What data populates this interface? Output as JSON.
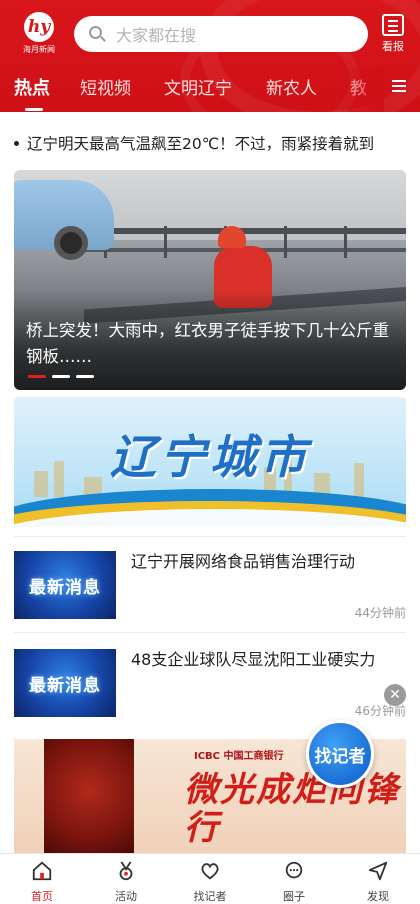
{
  "header": {
    "logo_text": "海月新闻",
    "search_placeholder": "大家都在搜",
    "paper_label": "看报"
  },
  "tabs": [
    {
      "label": "热点",
      "active": true
    },
    {
      "label": "短视频"
    },
    {
      "label": "文明辽宁"
    },
    {
      "label": "新农人"
    },
    {
      "label": "教"
    }
  ],
  "ticker": {
    "text": "辽宁明天最高气温飙至20℃！不过，雨紧接着就到"
  },
  "carousel": {
    "caption": "桥上突发！大雨中，红衣男子徒手按下几十公斤重钢板……",
    "slide_count": 3,
    "active_slide": 1
  },
  "banner": {
    "title": "辽宁城市"
  },
  "news": [
    {
      "thumb_text": "最新消息",
      "title": "辽宁开展网络食品销售治理行动",
      "time": "44分钟前"
    },
    {
      "thumb_text": "最新消息",
      "title": "48支企业球队尽显沈阳工业硬实力",
      "time": "46分钟前"
    }
  ],
  "promo": {
    "bank_name": "ICBC 中国工商银行",
    "title": "微光成炬向锋行"
  },
  "fab": {
    "label": "找记者"
  },
  "bottom_nav": [
    {
      "label": "首页",
      "icon": "home-icon",
      "active": true
    },
    {
      "label": "活动",
      "icon": "medal-icon"
    },
    {
      "label": "找记者",
      "icon": "heart-icon"
    },
    {
      "label": "圈子",
      "icon": "chat-bubble-icon"
    },
    {
      "label": "发现",
      "icon": "paper-plane-icon"
    }
  ],
  "colors": {
    "brand_red": "#d8161b",
    "accent_blue": "#1b6fd8"
  }
}
